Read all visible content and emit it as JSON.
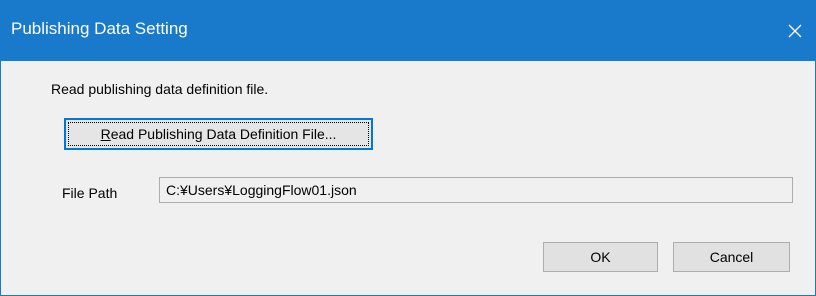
{
  "window": {
    "title": "Publishing Data Setting",
    "titlebar_color": "#1979ca"
  },
  "content": {
    "instruction": "Read publishing data definition file.",
    "read_button_label_mnemonic": "R",
    "read_button_label_rest": "ead Publishing Data Definition File...",
    "file_path_label": "File Path",
    "file_path_value": "C:¥Users¥LoggingFlow01.json"
  },
  "buttons": {
    "ok": "OK",
    "cancel": "Cancel"
  },
  "icons": {
    "close": "close-icon"
  }
}
